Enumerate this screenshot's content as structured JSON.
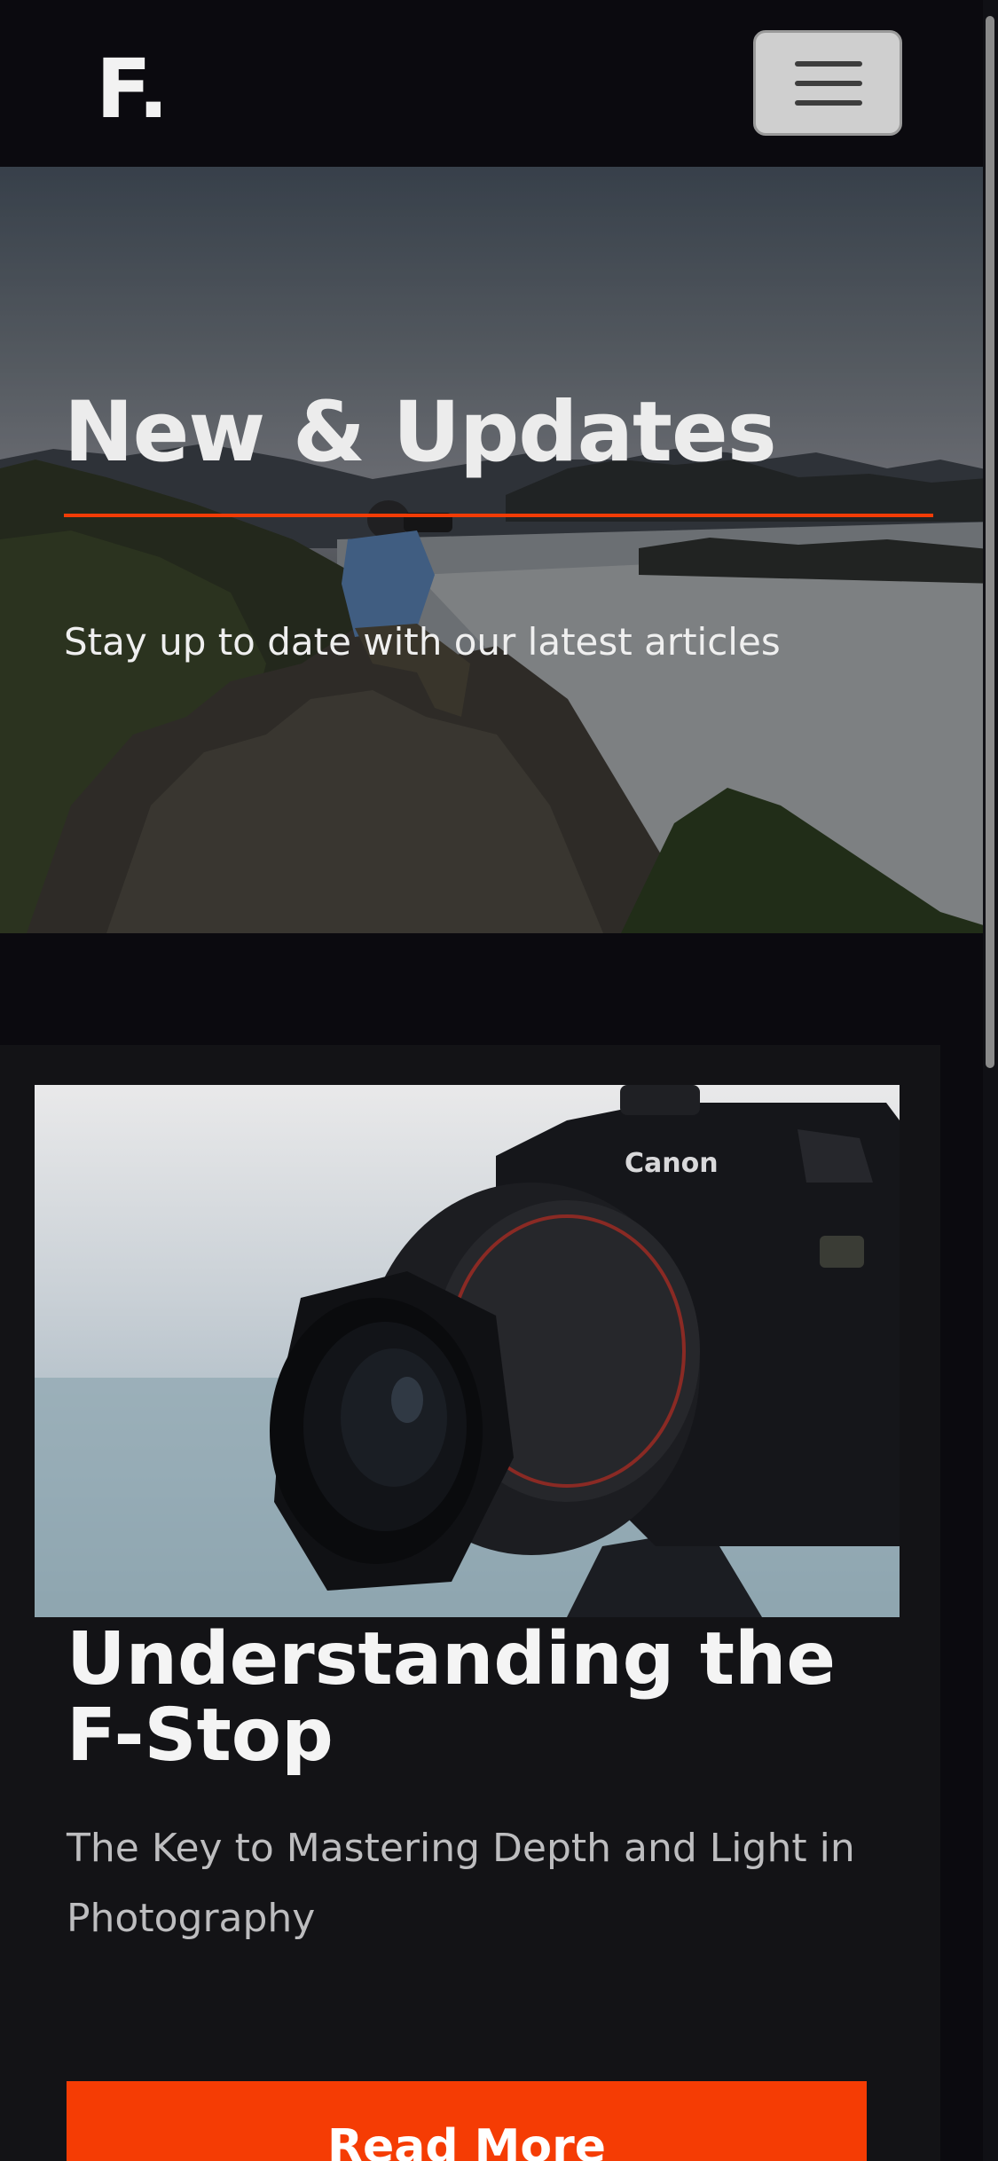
{
  "navbar": {
    "brand": "F.",
    "menu_icon": "hamburger-menu-icon"
  },
  "hero": {
    "title": "New & Updates",
    "subtitle": "Stay up to date with our latest articles",
    "accent_color": "#f23c06",
    "image": "photographer-on-mountain-peak-above-clouds"
  },
  "article": {
    "image": "canon-dslr-camera-with-zoom-lens",
    "camera_brand_text": "Canon",
    "title": "Understanding the F-Stop",
    "subtitle": "The Key to Mastering Depth and Light in Photography",
    "cta_label": "Read More",
    "cta_color": "#f53c04"
  },
  "colors": {
    "page_background": "#0b0a0f",
    "card_background": "#131316"
  }
}
